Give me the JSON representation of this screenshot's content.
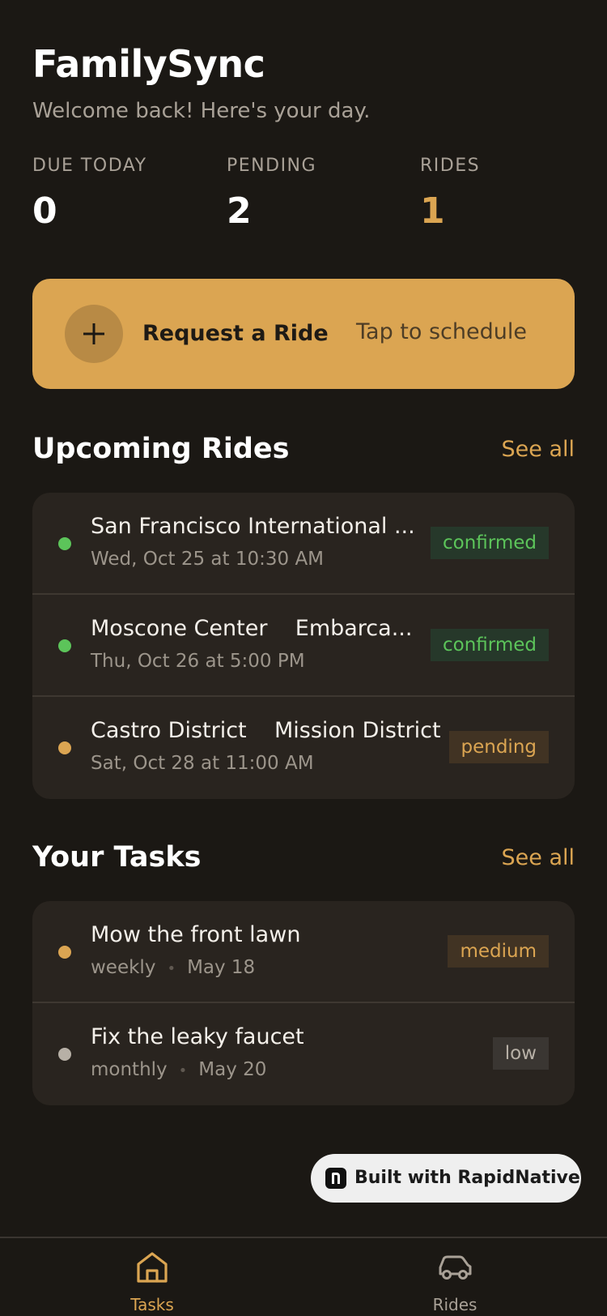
{
  "header": {
    "title": "FamilySync",
    "subtitle": "Welcome back! Here's your day."
  },
  "stats": [
    {
      "label": "DUE TODAY",
      "value": "0"
    },
    {
      "label": "PENDING",
      "value": "2"
    },
    {
      "label": "RIDES",
      "value": "1"
    }
  ],
  "cta": {
    "label": "Request a Ride",
    "hint": "Tap to schedule"
  },
  "rides_section": {
    "title": "Upcoming Rides",
    "see_all": "See all",
    "items": [
      {
        "title": "San Francisco International ...",
        "subtitle": "Wed, Oct 25 at 10:30 AM",
        "status": "confirmed",
        "status_color": "#5cc45a"
      },
      {
        "title": "Moscone Center    Embarca...",
        "subtitle": "Thu, Oct 26 at 5:00 PM",
        "status": "confirmed",
        "status_color": "#5cc45a"
      },
      {
        "title": "Castro District    Mission District",
        "subtitle": "Sat, Oct 28 at 11:00 AM",
        "status": "pending",
        "status_color": "#dba552"
      }
    ]
  },
  "tasks_section": {
    "title": "Your Tasks",
    "see_all": "See all",
    "items": [
      {
        "title": "Mow the front lawn",
        "frequency": "weekly",
        "separator": "•",
        "due": "May 18",
        "priority": "medium",
        "dot_color": "#dba552"
      },
      {
        "title": "Fix the leaky faucet",
        "frequency": "monthly",
        "separator": "•",
        "due": "May 20",
        "priority": "low",
        "dot_color": "#b7b0a6"
      }
    ]
  },
  "built_with": {
    "label": "Built with RapidNative"
  },
  "tabbar": {
    "tabs": [
      {
        "label": "Tasks",
        "icon": "home-icon",
        "active": true
      },
      {
        "label": "Rides",
        "icon": "car-icon",
        "active": false
      }
    ]
  },
  "colors": {
    "background": "#1b1814",
    "accent": "#dba552",
    "card": "#29241f",
    "confirmed": "#5cc45a"
  }
}
